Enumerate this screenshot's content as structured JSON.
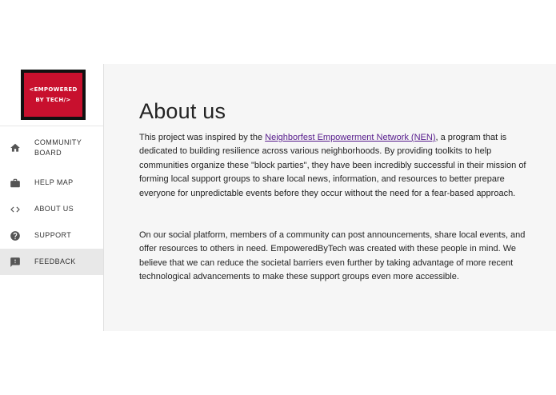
{
  "logo": {
    "line1": "<EMPOWERED",
    "line2": "BY TECH/>",
    "bg_color": "#c8102e",
    "frame_color": "#111111"
  },
  "nav": {
    "items": [
      {
        "label": "COMMUNITY BOARD",
        "icon": "home-icon"
      },
      {
        "label": "HELP MAP",
        "icon": "briefcase-icon"
      },
      {
        "label": "ABOUT US",
        "icon": "code-icon"
      },
      {
        "label": "SUPPORT",
        "icon": "help-icon"
      },
      {
        "label": "FEEDBACK",
        "icon": "feedback-icon",
        "active": true
      }
    ]
  },
  "page": {
    "title": "About us",
    "para1_before": "This project was inspired by the ",
    "para1_link": "Neighborfest Empowerment Network (NEN)",
    "para1_after": ", a program that is dedicated to building resilience across various neighborhoods. By providing toolkits to help communities organize these \"block parties\", they have been incredibly successful in their mission of forming local support groups to share local news, information, and resources to better prepare everyone for unpredictable events before they occur without the need for a fear-based approach.",
    "para2": "On our social platform, members of a community can post announcements, share local events, and offer resources to others in need. EmpoweredByTech was created with these people in mind. We believe that we can reduce the societal barriers even further by taking advantage of more recent technological advancements to make these support groups even more accessible."
  },
  "colors": {
    "link": "#551a8b",
    "main_bg": "#f6f6f6",
    "active_nav_bg": "#e8e8e8"
  }
}
